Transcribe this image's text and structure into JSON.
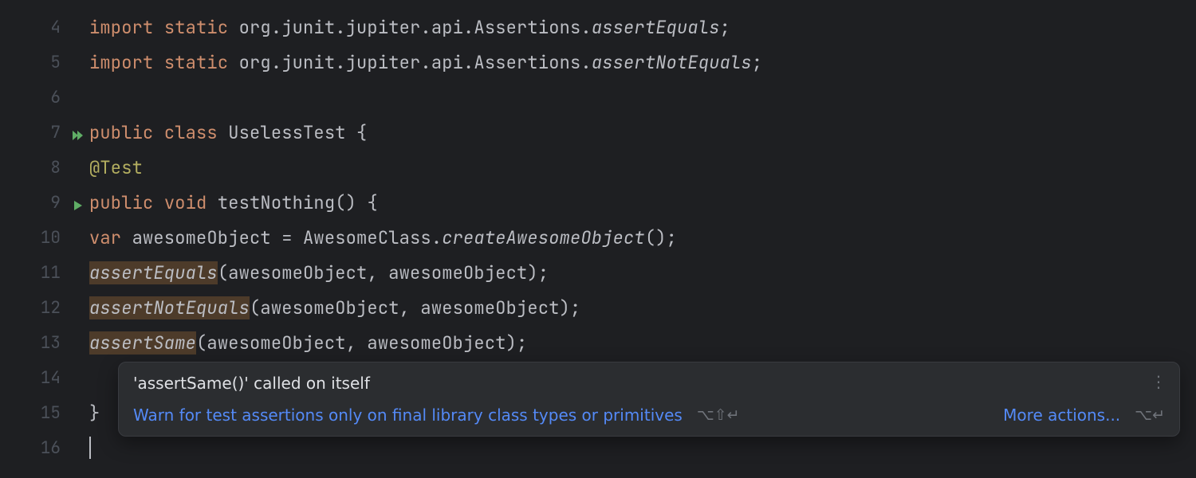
{
  "gutter": {
    "start": 4,
    "end": 16,
    "run_icons": {
      "7": "double",
      "9": "single"
    }
  },
  "code": {
    "l4": {
      "kw1": "import",
      "kw2": "static",
      "pkg": "org.junit.jupiter.api.Assertions.",
      "member": "assertEquals",
      "end": ";"
    },
    "l5": {
      "kw1": "import",
      "kw2": "static",
      "pkg": "org.junit.jupiter.api.Assertions.",
      "member": "assertNotEquals",
      "end": ";"
    },
    "l7": {
      "kw1": "public",
      "kw2": "class",
      "name": "UselessTest",
      "brace": " {"
    },
    "l8": {
      "anno": "@Test"
    },
    "l9": {
      "kw1": "public",
      "kw2": "void",
      "name": "testNothing",
      "paren": "()",
      "brace": " {"
    },
    "l10": {
      "kw": "var",
      "var": "awesomeObject",
      "eq": " = ",
      "cls": "AwesomeClass",
      "dot": ".",
      "method": "createAwesomeObject",
      "tail": "();"
    },
    "l11": {
      "fn": "assertEquals",
      "args": "(awesomeObject, awesomeObject);"
    },
    "l12": {
      "fn": "assertNotEquals",
      "args": "(awesomeObject, awesomeObject);"
    },
    "l13": {
      "fn": "assertSame",
      "args": "(awesomeObject, awesomeObject);"
    },
    "l15": {
      "brace": "}"
    }
  },
  "tooltip": {
    "title": "'assertSame()' called on itself",
    "fix": "Warn for test assertions only on final library class types or primitives",
    "shortcut1": "⌥⇧↵",
    "more": "More actions...",
    "shortcut2": "⌥↵"
  }
}
